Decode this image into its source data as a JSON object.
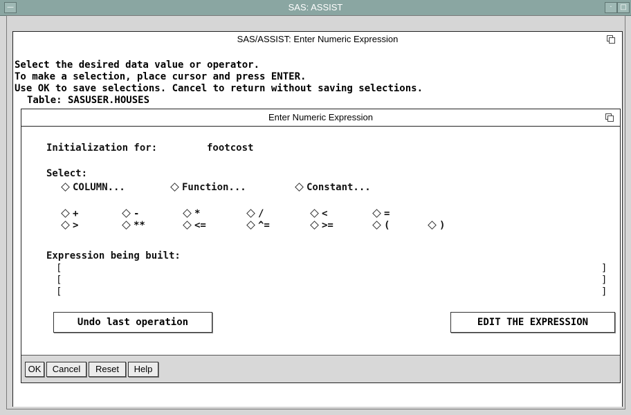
{
  "outer_window": {
    "title": "SAS: ASSIST"
  },
  "assist_window": {
    "title": "SAS/ASSIST: Enter Numeric Expression",
    "instructions": [
      "Select the desired data value or operator.",
      "To make a selection, place cursor and press ENTER.",
      "Use OK to save selections. Cancel to return without saving selections."
    ],
    "table_line": "Table: SASUSER.HOUSES"
  },
  "dialog": {
    "title": "Enter Numeric Expression",
    "initialization_label": "Initialization for:",
    "initialization_value": "footcost",
    "select_label": "Select:",
    "select_options": [
      "COLUMN...",
      "Function...",
      "Constant..."
    ],
    "operators_row1": [
      "+",
      "-",
      "*",
      "/",
      "<",
      "="
    ],
    "operators_row2": [
      ">",
      "**",
      "<=",
      "^=",
      ">=",
      "(",
      ")"
    ],
    "expression_label": "Expression being built:",
    "undo_button": "Undo last operation",
    "edit_button": "EDIT THE EXPRESSION",
    "footer_buttons": [
      "OK",
      "Cancel",
      "Reset",
      "Help"
    ]
  }
}
